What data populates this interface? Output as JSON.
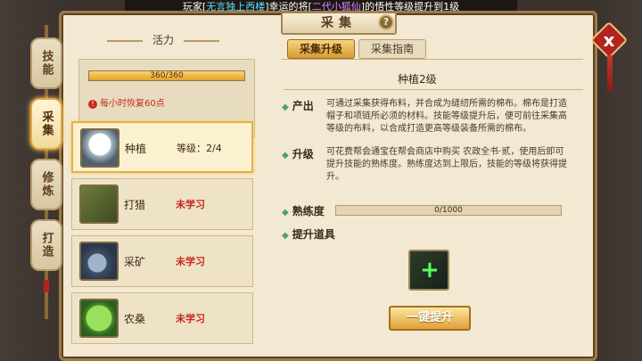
{
  "broadcast": {
    "prefix": "玩家[",
    "player": "无言独上西楼",
    "middle1": "]幸运的将[",
    "pet": "二代小狐仙",
    "suffix": "]的悟性等级提升到1级"
  },
  "window": {
    "title": "采集",
    "help_icon": "?",
    "close_icon": "x"
  },
  "side_tabs": [
    {
      "label": "技能",
      "active": false
    },
    {
      "label": "采集",
      "active": true
    },
    {
      "label": "修炼",
      "active": false
    },
    {
      "label": "打造",
      "active": false
    }
  ],
  "vitality": {
    "header": "活力",
    "bar_text": "360/360",
    "fraction": 1.0,
    "note": "每小时恢复60点"
  },
  "skills": [
    {
      "name": "种植",
      "level_label": "等级：2/4",
      "status": "",
      "icon": "cotton-icon",
      "selected": true
    },
    {
      "name": "打猎",
      "level_label": "",
      "status": "未学习",
      "icon": "hunting-icon",
      "selected": false
    },
    {
      "name": "采矿",
      "level_label": "",
      "status": "未学习",
      "icon": "ore-icon",
      "selected": false
    },
    {
      "name": "农桑",
      "level_label": "",
      "status": "未学习",
      "icon": "leaf-icon",
      "selected": false
    }
  ],
  "tabs": {
    "upgrade": "采集升级",
    "guide": "采集指南"
  },
  "detail": {
    "subtitle": "种植2级",
    "output_label": "产出",
    "output_text": "可通过采集获得布料，并合成为缝纫所需的棉布。棉布是打造帽子和项链所必须的材料。技能等级提升后，便可前往采集高等级的布料，以合成打造更高等级装备所需的棉布。",
    "upgrade_label": "升级",
    "upgrade_text": "可花费帮会通宝在帮会商店中购买 农政全书·贰，使用后即可提升技能的熟练度。熟练度达到上限后，技能的等级将获得提升。",
    "proficiency_label": "熟练度",
    "proficiency_text": "0/1000",
    "proficiency_fraction": 0,
    "item_label": "提升道具",
    "oneclick_label": "一键提升"
  }
}
